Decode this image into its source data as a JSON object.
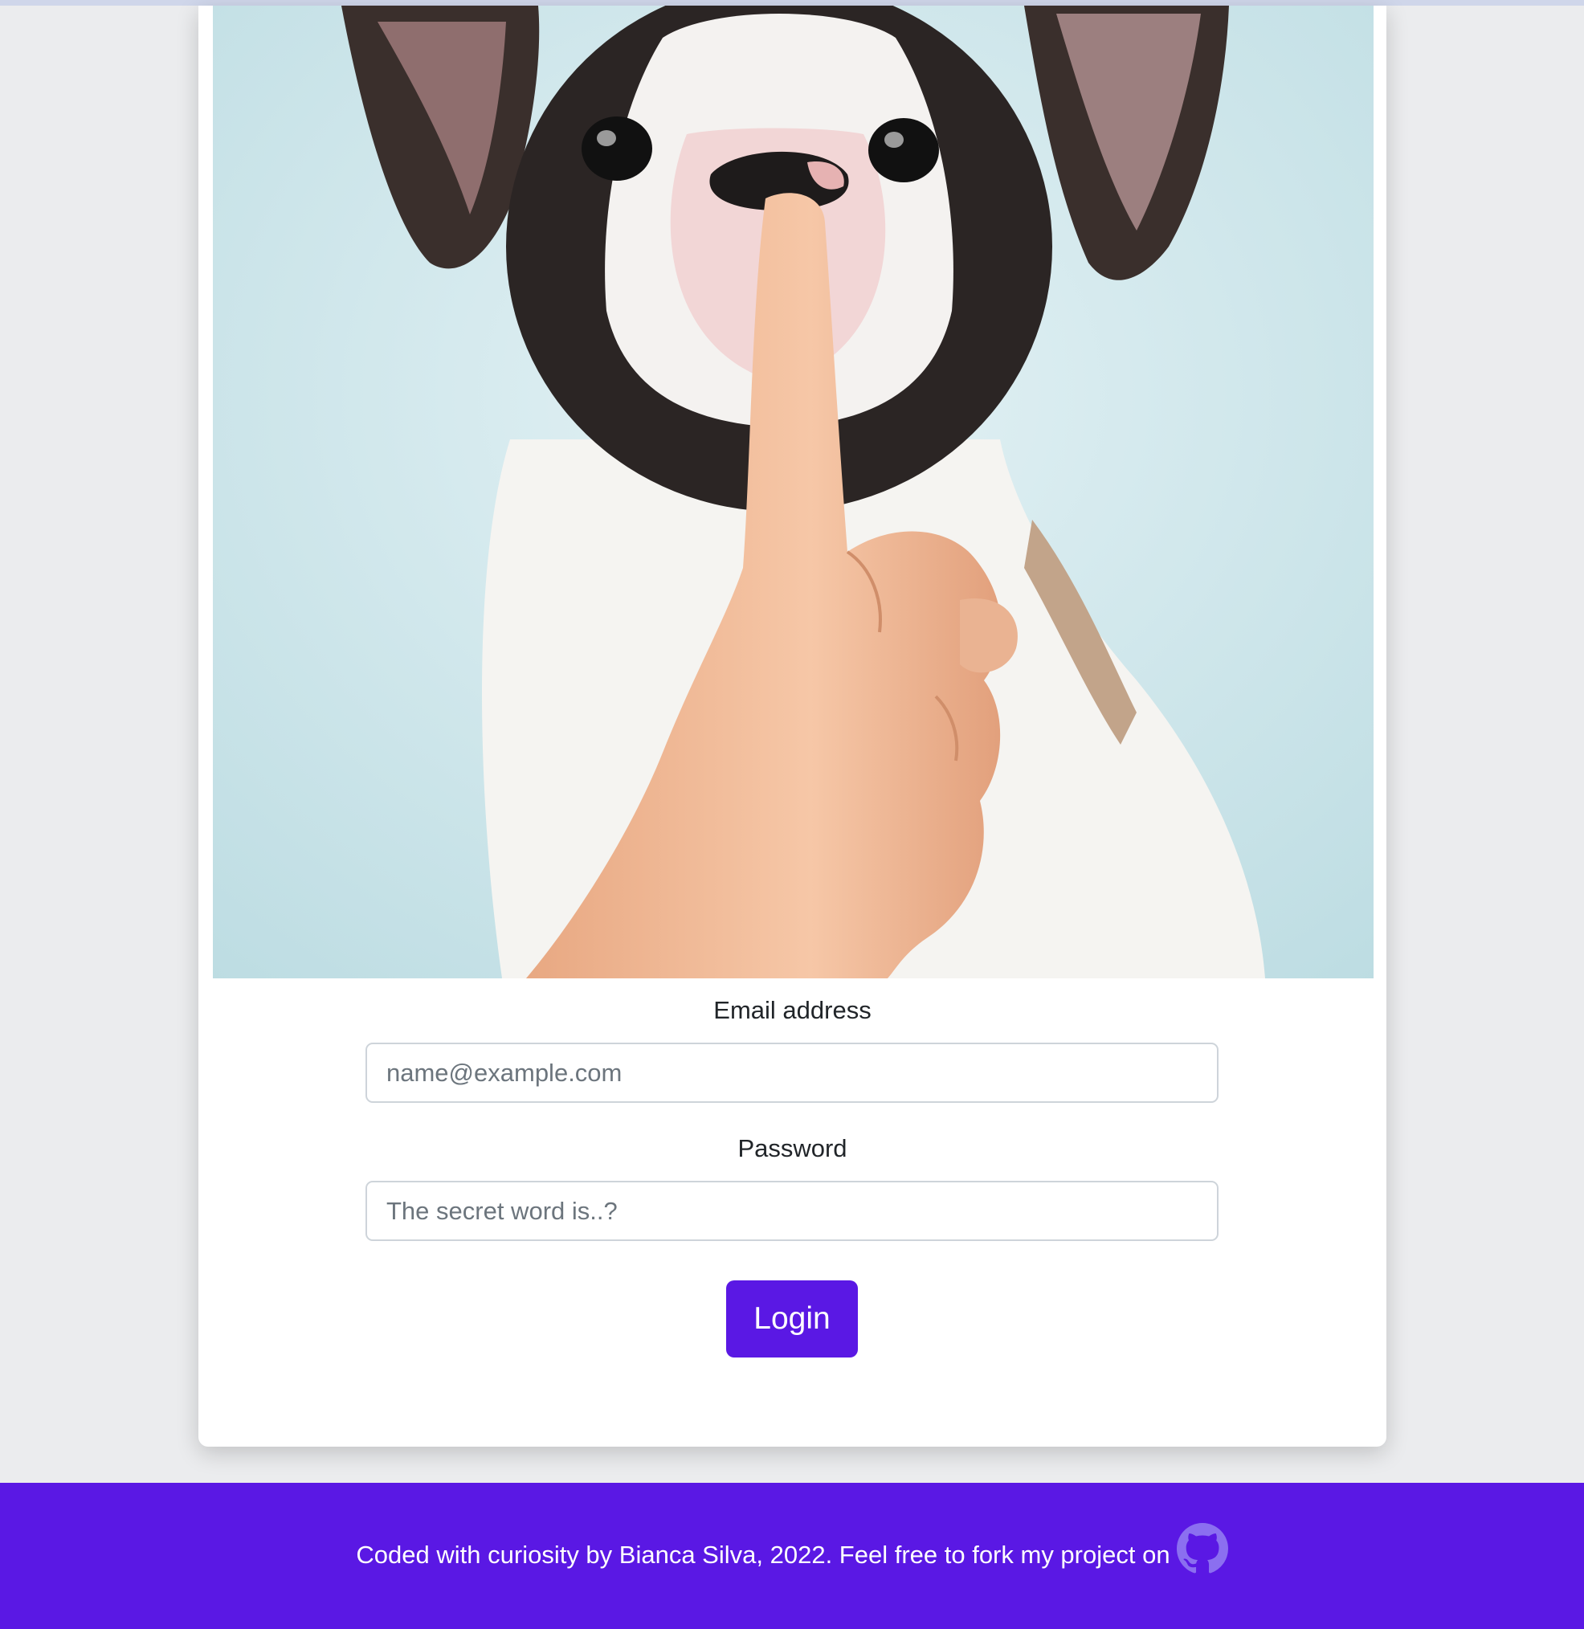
{
  "login_form": {
    "email_label": "Email address",
    "email_placeholder": "name@example.com",
    "password_label": "Password",
    "password_placeholder": "The secret word is..?",
    "login_button": "Login"
  },
  "footer": {
    "text": "Coded with curiosity by Bianca Silva, 2022. Feel free to fork my project on",
    "link_icon": "github-icon"
  },
  "colors": {
    "accent": "#5a18e4",
    "page_background": "#ebecee",
    "card_background": "#ffffff",
    "photo_background": "#d9ecf0"
  },
  "hero_image": {
    "subject": "french-bulldog-puppy-with-finger-on-nose"
  }
}
